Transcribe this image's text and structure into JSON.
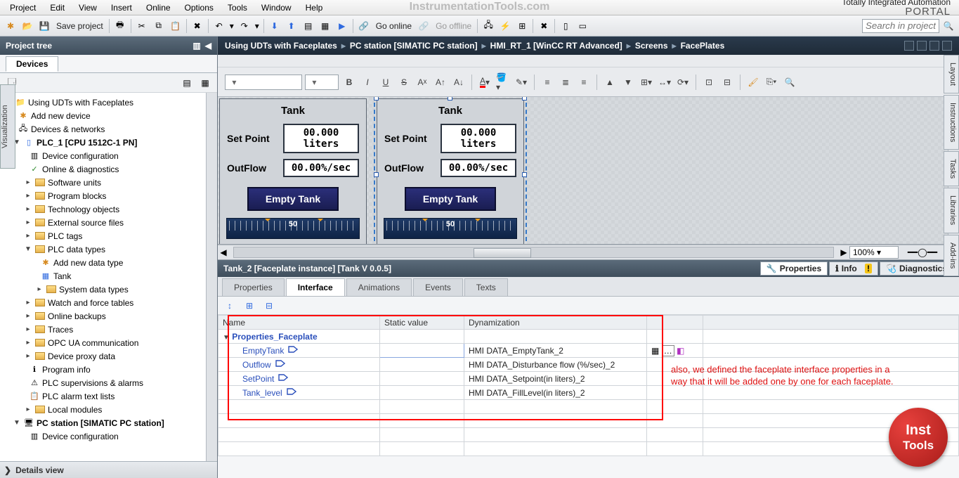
{
  "menu": {
    "items": [
      "Project",
      "Edit",
      "View",
      "Insert",
      "Online",
      "Options",
      "Tools",
      "Window",
      "Help"
    ]
  },
  "watermark": "InstrumentationTools.com",
  "brand": {
    "line1": "Totally Integrated Automation",
    "line2": "PORTAL"
  },
  "toolbar": {
    "save_label": "Save project",
    "go_online": "Go online",
    "go_offline": "Go offline",
    "search_placeholder": "Search in project"
  },
  "project_tree": {
    "title": "Project tree",
    "devices_tab": "Devices",
    "details": "Details view",
    "nodes": {
      "root": "Using UDTs with Faceplates",
      "add_device": "Add new device",
      "devices_networks": "Devices & networks",
      "plc": "PLC_1 [CPU 1512C-1 PN]",
      "dev_conf": "Device configuration",
      "online_diag": "Online & diagnostics",
      "sw_units": "Software units",
      "prog_blocks": "Program blocks",
      "tech_obj": "Technology objects",
      "ext_src": "External source files",
      "plc_tags": "PLC tags",
      "plc_dtypes": "PLC data types",
      "add_dtype": "Add new data type",
      "tank_type": "Tank",
      "sys_dtypes": "System data types",
      "watch": "Watch and force tables",
      "backups": "Online backups",
      "traces": "Traces",
      "opcua": "OPC UA communication",
      "proxy": "Device proxy data",
      "prog_info": "Program info",
      "supervisions": "PLC supervisions & alarms",
      "alarm_lists": "PLC alarm text lists",
      "local_mods": "Local modules",
      "pc_station": "PC station [SIMATIC PC station]",
      "pc_dev_conf": "Device configuration"
    }
  },
  "vtab_left": "Visualization",
  "rtabs": [
    "Layout",
    "Instructions",
    "Tasks",
    "Libraries",
    "Add-ins"
  ],
  "breadcrumb": [
    "Using UDTs with Faceplates",
    "PC station [SIMATIC PC station]",
    "HMI_RT_1 [WinCC RT Advanced]",
    "Screens",
    "FacePlates"
  ],
  "faceplate": {
    "title": "Tank",
    "setpoint_label": "Set Point",
    "setpoint_value": "00.000 liters",
    "outflow_label": "OutFlow",
    "outflow_value": "00.00%/sec",
    "button": "Empty Tank",
    "gauge_mid": "50"
  },
  "zoom": "100%",
  "inspector": {
    "title": "Tank_2 [Faceplate instance] [Tank V 0.0.5]",
    "right_tabs": {
      "properties": "Properties",
      "info": "Info",
      "diagnostics": "Diagnostics"
    },
    "subtabs": [
      "Properties",
      "Interface",
      "Animations",
      "Events",
      "Texts"
    ],
    "columns": {
      "name": "Name",
      "static": "Static value",
      "dyn": "Dynamization"
    },
    "group": "Properties_Faceplate",
    "rows": [
      {
        "name": "EmptyTank",
        "dyn": "HMI DATA_EmptyTank_2"
      },
      {
        "name": "Outflow",
        "dyn": "HMI DATA_Disturbance flow (%/sec)_2"
      },
      {
        "name": "SetPoint",
        "dyn": "HMI DATA_Setpoint(in liters)_2"
      },
      {
        "name": "Tank_level",
        "dyn": "HMI DATA_FillLevel(in liters)_2"
      }
    ]
  },
  "annotation": "also, we defined the faceplate interface properties in a way that it will be added one by one for each faceplate.",
  "badge": {
    "l1": "Inst",
    "l2": "Tools"
  }
}
